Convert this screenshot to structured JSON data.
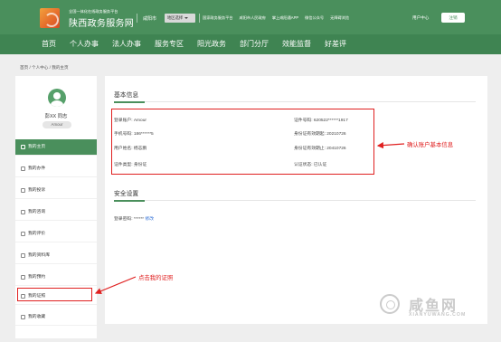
{
  "header": {
    "subtitle": "全国一体化在线政务服务平台",
    "title": "陕西政务服务网",
    "city": "咸阳市",
    "region_select": "地区选择",
    "links": [
      "国家政务服务平台",
      "咸阳市人民政府",
      "掌上咸阳通APP",
      "微信公众号",
      "无障碍浏览"
    ],
    "user_center": "用户中心",
    "register": "注销",
    "brand_color": "#4a8f5c"
  },
  "nav": {
    "items": [
      "首页",
      "个人办事",
      "法人办事",
      "服务专区",
      "阳光政务",
      "部门分厅",
      "效能监督",
      "好差评"
    ]
  },
  "breadcrumb": "首页 / 个人中心 / 我的主页",
  "sidebar": {
    "user_name": "彭XX 同志",
    "user_badge": "Amour",
    "menu": [
      {
        "label": "我的主页",
        "icon": "home-icon",
        "active": true
      },
      {
        "label": "我的办件",
        "icon": "folder-icon",
        "active": false
      },
      {
        "label": "我的投诉",
        "icon": "complaint-icon",
        "active": false
      },
      {
        "label": "我的咨询",
        "icon": "chat-icon",
        "active": false
      },
      {
        "label": "我的评价",
        "icon": "thumb-icon",
        "active": false
      },
      {
        "label": "我的资料库",
        "icon": "archive-icon",
        "active": false
      },
      {
        "label": "我的预约",
        "icon": "calendar-icon",
        "active": false
      },
      {
        "label": "我的证照",
        "icon": "id-card-icon",
        "active": false
      },
      {
        "label": "我的收藏",
        "icon": "star-icon",
        "active": false
      }
    ]
  },
  "basic_info": {
    "title": "基本信息",
    "login_account": "登录账户: Amour",
    "phone": "手机号码: 186******5",
    "user_name": "用户姓名: 杨志鹏",
    "cert_type": "证件类型: 身份证",
    "cert_no": "证件号码: 620522******1917",
    "id_valid_start": "身份证有效期起: 20210726",
    "id_valid_end": "身份证有效期止: 20410726",
    "auth_status": "认证状态: 已认证"
  },
  "security": {
    "title": "安全设置",
    "password_label": "登录密码: ******",
    "edit_link": "修改"
  },
  "annotations": {
    "confirm_info": "确认账户基本信息",
    "click_license": "点击我的证照",
    "color": "#e02020"
  },
  "watermark": {
    "title": "咸鱼网",
    "url": "XIANYUWANG.COM"
  }
}
